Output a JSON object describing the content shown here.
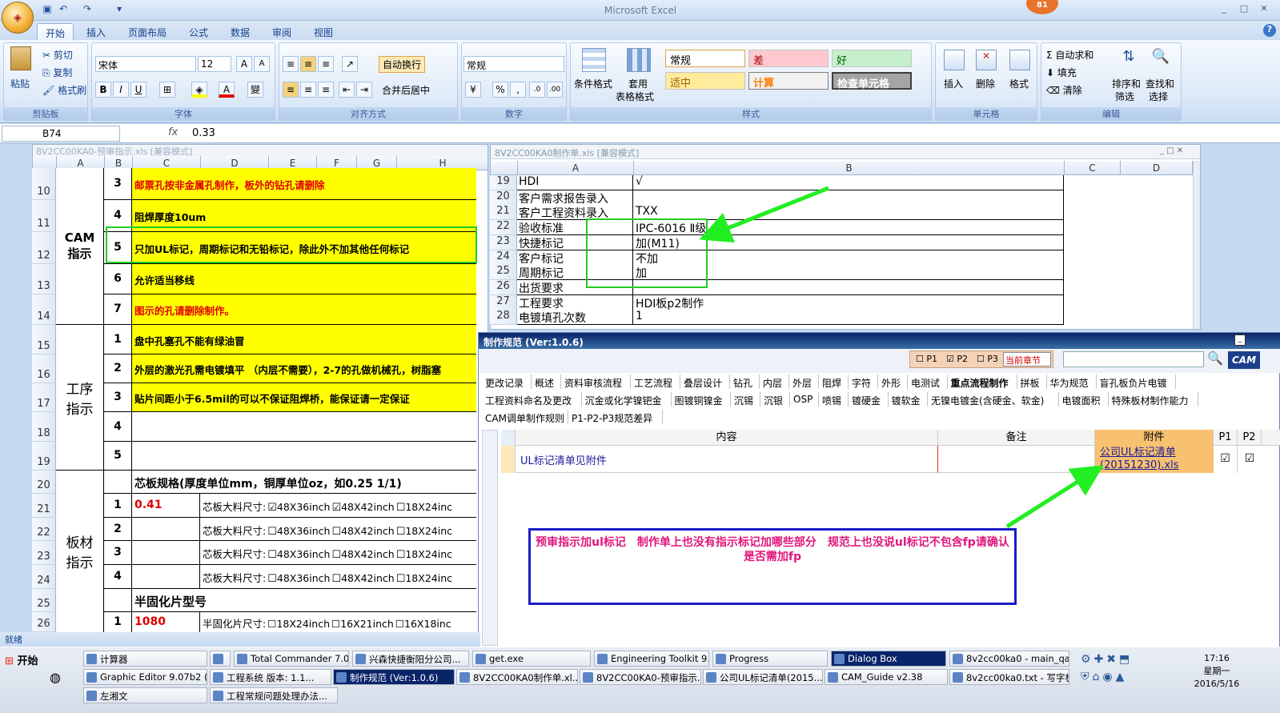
{
  "app": {
    "title": "Microsoft Excel",
    "notification_count": "81",
    "office_button_label": "Office"
  },
  "ribbon": {
    "tabs": [
      "开始",
      "插入",
      "页面布局",
      "公式",
      "数据",
      "审阅",
      "视图"
    ],
    "clipboard": {
      "paste": "粘贴",
      "cut": "剪切",
      "copy": "复制",
      "format_painter": "格式刷",
      "label": "剪贴板"
    },
    "font": {
      "name": "宋体",
      "size": "12",
      "grow": "A",
      "shrink": "A",
      "bold": "B",
      "italic": "I",
      "underline": "U",
      "label": "字体"
    },
    "alignment": {
      "wrap": "自动换行",
      "merge": "合并后居中",
      "label": "对齐方式"
    },
    "number": {
      "format": "常规",
      "percent": "%",
      "comma": ",",
      "label": "数字"
    },
    "styles": {
      "conditional": "条件格式",
      "table": "套用",
      "table2": "表格格式",
      "cells": [
        "常规",
        "差",
        "好",
        "适中",
        "计算",
        "检查单元格"
      ],
      "label": "样式"
    },
    "cells": {
      "insert": "插入",
      "delete": "删除",
      "format": "格式",
      "label": "单元格"
    },
    "editing": {
      "autosum": "自动求和",
      "fill": "填充",
      "clear": "清除",
      "sort": "排序和",
      "sort2": "筛选",
      "find": "查找和",
      "find2": "选择",
      "label": "编辑"
    }
  },
  "formula_bar": {
    "cell_ref": "B74",
    "fx": "fx",
    "value": "0.33"
  },
  "sheet1": {
    "title": "8V2CC00KA0-预审指示.xls [兼容模式]",
    "columns": [
      "A",
      "B",
      "C",
      "D",
      "E",
      "F",
      "G",
      "H"
    ],
    "rows": [
      "10",
      "11",
      "12",
      "13",
      "14",
      "15",
      "16",
      "17",
      "18",
      "19",
      "20",
      "21",
      "22",
      "23",
      "24",
      "25",
      "26"
    ],
    "cam_label": "CAM\n指示",
    "cam_items": [
      {
        "n": "3",
        "text": "邮票孔按非金属孔制作，板外的钻孔请删除",
        "style": "red"
      },
      {
        "n": "4",
        "text": "阻焊厚度10um",
        "style": "bold"
      },
      {
        "n": "5",
        "text": "只加UL标记，周期标记和无铅标记，除此外不加其他任何标记",
        "style": "bold"
      },
      {
        "n": "6",
        "text": "允许适当移线",
        "style": "bold"
      },
      {
        "n": "7",
        "text": "图示的孔请删除制作。",
        "style": "red"
      }
    ],
    "process_label": "工序\n指示",
    "process_items": [
      {
        "n": "1",
        "text": "盘中孔塞孔不能有绿油冒"
      },
      {
        "n": "2",
        "text": "外层的激光孔需电镀填平 （内层不需要），2-7的孔做机械孔，树脂塞"
      },
      {
        "n": "3",
        "text": "贴片间距小于6.5mil的可以不保证阻焊桥，能保证请一定保证"
      },
      {
        "n": "4",
        "text": ""
      },
      {
        "n": "5",
        "text": ""
      }
    ],
    "material_label": "板材\n指示",
    "core_header": "芯板规格(厚度单位mm，铜厚单位oz，如0.25 1/1)",
    "core_rows": [
      {
        "n": "1",
        "val": "0.41",
        "label": "芯板大料尺寸:",
        "o1": "48X36inch",
        "o2": "48X42inch",
        "o3": "18X24inc",
        "c1": "☑",
        "c2": "☑",
        "c3": "☐"
      },
      {
        "n": "2",
        "val": "",
        "label": "芯板大料尺寸:",
        "o1": "48X36inch",
        "o2": "48X42inch",
        "o3": "18X24inc",
        "c1": "☐",
        "c2": "☐",
        "c3": "☐"
      },
      {
        "n": "3",
        "val": "",
        "label": "芯板大料尺寸:",
        "o1": "48X36inch",
        "o2": "48X42inch",
        "o3": "18X24inc",
        "c1": "☐",
        "c2": "☐",
        "c3": "☐"
      },
      {
        "n": "4",
        "val": "",
        "label": "芯板大料尺寸:",
        "o1": "48X36inch",
        "o2": "48X42inch",
        "o3": "18X24inc",
        "c1": "☐",
        "c2": "☐",
        "c3": "☐"
      }
    ],
    "prepreg_header": "半固化片型号",
    "prepreg_row": {
      "n": "1",
      "val": "1080",
      "label": "半固化片尺寸:",
      "o1": "18X24inch",
      "o2": "16X21inch",
      "o3": "16X18inc",
      "c": "☐"
    }
  },
  "sheet2": {
    "title": "8V2CC00KA0制作单.xls [兼容模式]",
    "columns": [
      "A",
      "B",
      "C",
      "D"
    ],
    "rows": [
      {
        "n": "19",
        "a": "HDI",
        "b": "√"
      },
      {
        "n": "20",
        "a": "客户需求报告录入",
        "b": ""
      },
      {
        "n": "21",
        "a": "客户工程资料录入",
        "b": "TXX"
      },
      {
        "n": "22",
        "a": "验收标准",
        "b": "IPC-6016 Ⅱ级"
      },
      {
        "n": "23",
        "a": "快捷标记",
        "b": "加(M11)"
      },
      {
        "n": "24",
        "a": "客户标记",
        "b": "不加"
      },
      {
        "n": "25",
        "a": "周期标记",
        "b": "加"
      },
      {
        "n": "26",
        "a": "出货要求",
        "b": ""
      },
      {
        "n": "27",
        "a": "工程要求",
        "b": "HDI板p2制作"
      },
      {
        "n": "28",
        "a": "电镀填孔次数",
        "b": "1"
      }
    ]
  },
  "dialog": {
    "title": "制作规范 (Ver:1.0.6)",
    "filters": {
      "p1": "P1",
      "p2": "P2",
      "p3": "P3",
      "scope": "当前章节",
      "search_placeholder": ""
    },
    "logo": "CAM",
    "tabs_row1": [
      "更改记录",
      "概述",
      "资料审核流程",
      "工艺流程",
      "叠层设计",
      "钻孔",
      "内层",
      "外层",
      "阻焊",
      "字符",
      "外形",
      "电测试",
      "重点流程制作",
      "拼板",
      "华为规范",
      "盲孔板负片电镀"
    ],
    "tabs_row2": [
      "工程资料命名及更改",
      "沉金或化学镍钯金",
      "图镀铜镍金",
      "沉锡",
      "沉银",
      "OSP",
      "喷锡",
      "镀硬金",
      "镀软金",
      "无镍电镀金(含硬金、软金)",
      "电镀面积",
      "特殊板材制作能力"
    ],
    "tabs_row3": [
      "CAM调单制作规则",
      "P1-P2-P3规范差异"
    ],
    "grid_headers": {
      "content": "内容",
      "remark": "备注",
      "attach": "附件",
      "p1": "P1",
      "p2": "P2"
    },
    "row": {
      "content": "UL标记清单见附件",
      "remark": "",
      "attach": "公司UL标记清单(20151230).xls",
      "p1": "☑",
      "p2": "☑"
    }
  },
  "annotation": "预审指示加ul标记　制作单上也没有指示标记加哪些部分　规范上也没说ul标记不包含fp请确认是否需加fp",
  "status": "就绪",
  "taskbar": {
    "start": "开始",
    "row1": [
      "计算器",
      "",
      "Total Commander 7.0 ...",
      "兴森快捷衡阳分公司...",
      "get.exe",
      "Engineering Toolkit 9.0...",
      "Progress",
      "Dialog Box",
      "8v2cc00ka0 - main_qa"
    ],
    "row2": [
      "Graphic Editor 9.07b2 (...",
      "工程系统 版本: 1.1...",
      "制作规范 (Ver:1.0.6)",
      "8V2CC00KA0制作单.xl...",
      "8V2CC00KA0-预审指示...",
      "公司UL标记清单(2015...",
      "CAM_Guide v2.38",
      "8v2cc00ka0.txt - 写字板"
    ],
    "row3": [
      "左湘文",
      "工程常规问题处理办法..."
    ],
    "time": "17:16",
    "weekday": "星期一",
    "date": "2016/5/16"
  },
  "colors": {
    "accent": "#15428b",
    "highlight": "#ffff00",
    "arrow": "#22ee22",
    "note_border": "#1c1cc8",
    "note_text": "#e0167d"
  }
}
